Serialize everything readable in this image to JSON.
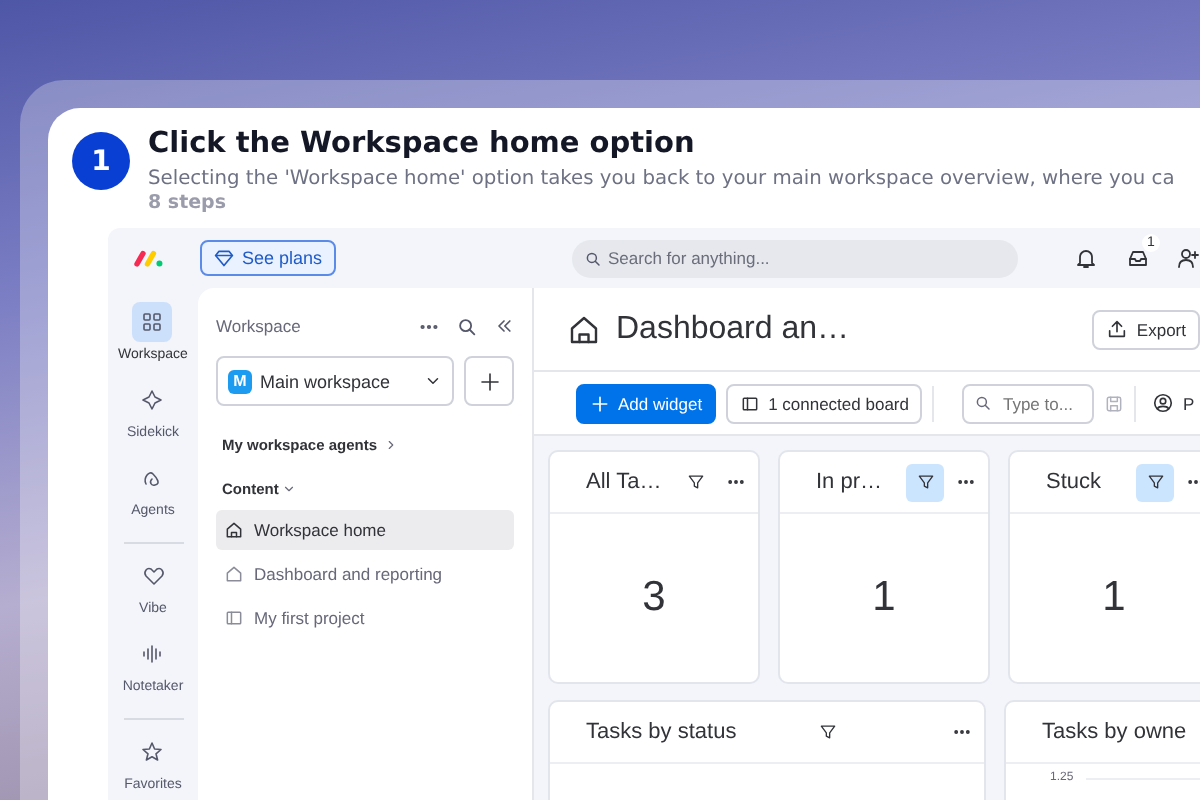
{
  "step": {
    "number": "1",
    "title": "Click the Workspace home option",
    "description": "Selecting the 'Workspace home' option takes you back to your main workspace overview, where you ca",
    "steps": "8 steps"
  },
  "topbar": {
    "plans_button": "See plans",
    "search": {
      "placeholder": "Search for anything..."
    },
    "inbox_badge": "1"
  },
  "rail_groups": [
    {
      "items": [
        {
          "label": "Workspace",
          "kind": "grid",
          "selected": true
        },
        {
          "label": "Sidekick",
          "kind": "sparkle",
          "selected": false
        },
        {
          "label": "Agents",
          "kind": "agent",
          "selected": false
        }
      ]
    },
    {
      "items": [
        {
          "label": "Vibe",
          "kind": "heart",
          "selected": false
        },
        {
          "label": "Notetaker",
          "kind": "wave",
          "selected": false
        }
      ]
    },
    {
      "items": [
        {
          "label": "Favorites",
          "kind": "star",
          "selected": false
        }
      ]
    }
  ],
  "sidebar": {
    "title": "Workspace",
    "workspace": {
      "name": "Main workspace",
      "avatar": "M"
    },
    "agents_link": "My workspace agents",
    "section": "Content",
    "items": [
      {
        "label": "Workspace home",
        "kind": "home",
        "selected": true
      },
      {
        "label": "Dashboard and reporting",
        "kind": "dashboard",
        "selected": false
      },
      {
        "label": "My first project",
        "kind": "board",
        "selected": false
      }
    ]
  },
  "dashboard": {
    "title": "Dashboard an…",
    "export_button": "Export",
    "add_button": "Add widget",
    "boards_button": "1 connected board",
    "filter_field": {
      "placeholder": "Type to..."
    },
    "person_filter": "P",
    "number_widgets": [
      {
        "title": "All Ta…",
        "value": "3",
        "filter_active": false
      },
      {
        "title": "In pr…",
        "value": "1",
        "filter_active": true
      },
      {
        "title": "Stuck",
        "value": "1",
        "filter_active": true
      }
    ],
    "chart_widgets": [
      {
        "title": "Tasks by status",
        "has_filter": true
      },
      {
        "title": "Tasks by owne",
        "has_filter": false,
        "tick": "1.25"
      }
    ]
  }
}
